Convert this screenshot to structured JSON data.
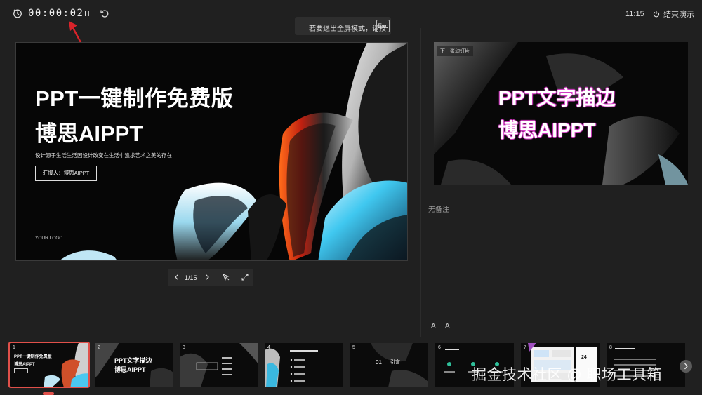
{
  "topbar": {
    "timer": "00:00:02",
    "esc_tip": "若要退出全屏模式，请按",
    "esc_key": "Esc",
    "clock": "11:15",
    "end_show": "结束演示"
  },
  "main_slide": {
    "title1": "PPT一键制作免费版",
    "title2": "博思AIPPT",
    "subtitle": "设计源于生活生活因设计改变在生活中追求艺术之美的存在",
    "reporter": "汇报人：博思AIPPT",
    "logo": "YOUR LOGO"
  },
  "nav": {
    "counter": "1/15"
  },
  "next_slide": {
    "label": "下一张幻灯片",
    "title1": "PPT文字描边",
    "title2": "博思AIPPT"
  },
  "notes": {
    "text": "无备注",
    "font_up": "A",
    "font_down": "A"
  },
  "thumbnails": [
    {
      "num": "1",
      "t1": "PPT一键制作免费版",
      "t2": "博思AIPPT"
    },
    {
      "num": "2",
      "t1": "PPT文字描边",
      "t2": "博思AIPPT"
    },
    {
      "num": "3",
      "t1": "",
      "t2": ""
    },
    {
      "num": "4",
      "t1": "",
      "t2": ""
    },
    {
      "num": "5",
      "t1": "01",
      "t2": "引言"
    },
    {
      "num": "6",
      "t1": "",
      "t2": ""
    },
    {
      "num": "7",
      "t1": "24",
      "t2": ""
    },
    {
      "num": "8",
      "t1": "",
      "t2": ""
    }
  ],
  "watermark": "掘金技术社区 @ 职场工具箱",
  "colors": {
    "accent": "#e0504a",
    "background": "#202020",
    "outline": "#e040d0"
  }
}
